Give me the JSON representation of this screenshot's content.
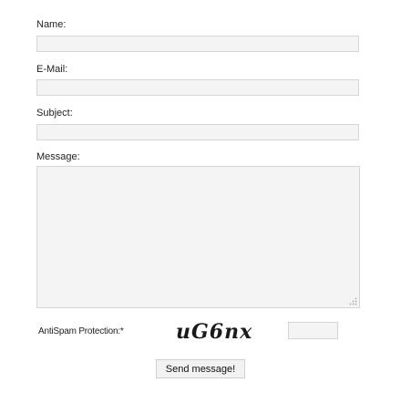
{
  "form": {
    "name_label": "Name:",
    "email_label": "E-Mail:",
    "subject_label": "Subject:",
    "message_label": "Message:",
    "antispam_label": "AntiSpam Protection:*",
    "captcha_text": "uG6nx",
    "send_label": "Send message!"
  },
  "fields": {
    "name_value": "",
    "email_value": "",
    "subject_value": "",
    "message_value": "",
    "captcha_value": ""
  },
  "icons": {
    "resize_grip": "resize-grip-icon"
  }
}
